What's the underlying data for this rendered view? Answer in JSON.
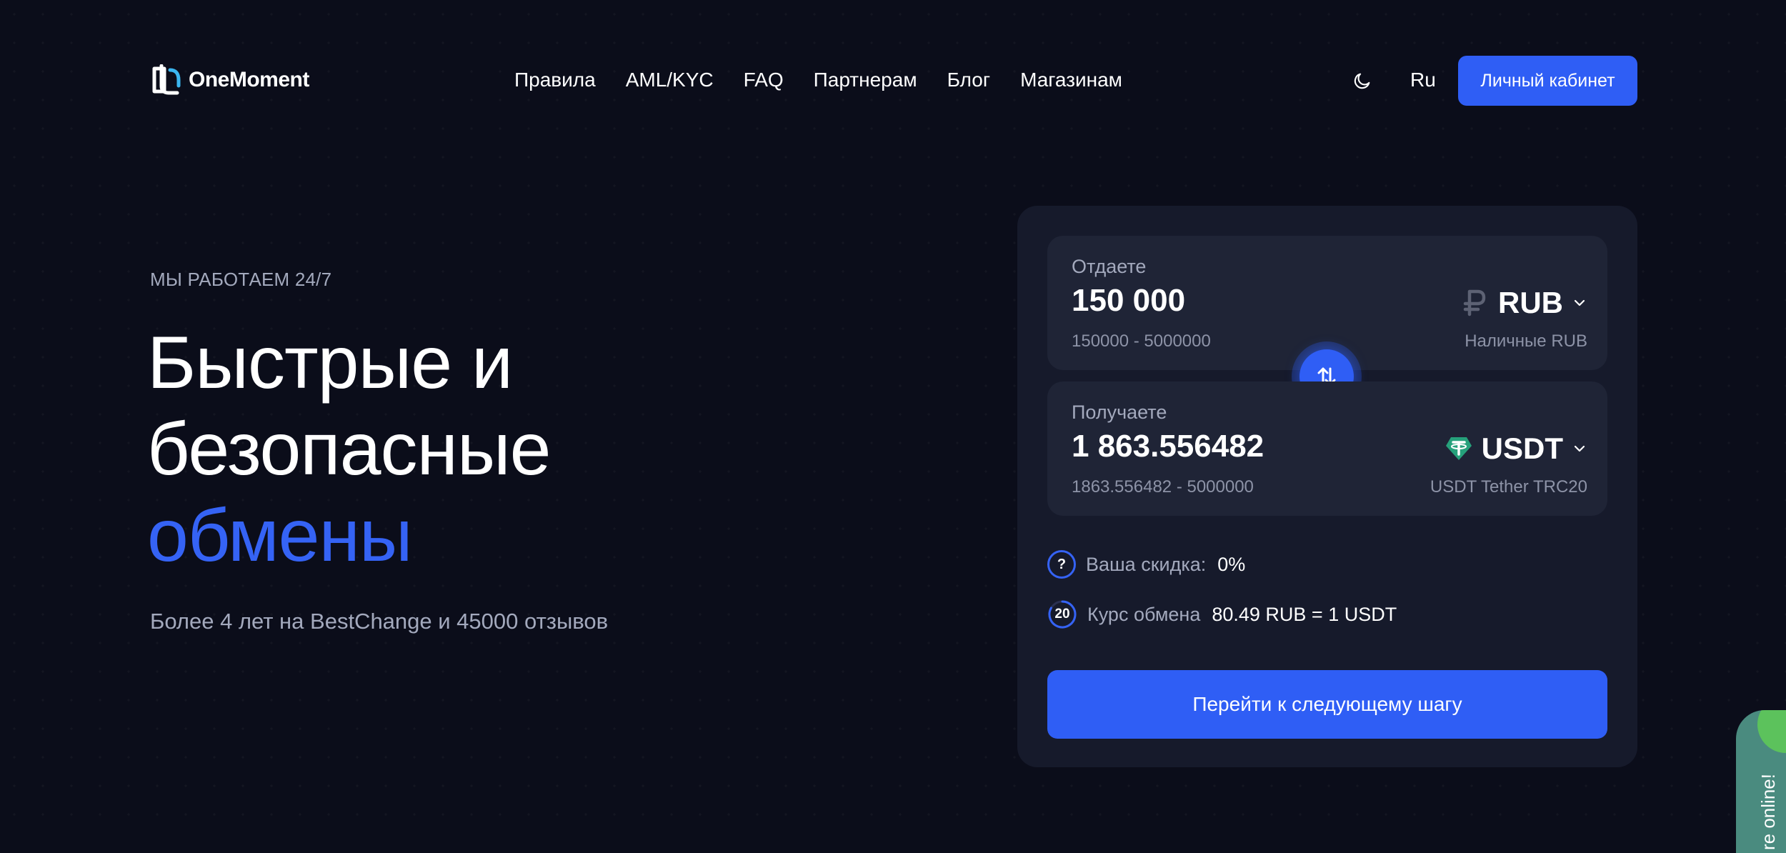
{
  "header": {
    "logo_text": "OneMoment",
    "nav": [
      "Правила",
      "AML/KYC",
      "FAQ",
      "Партнерам",
      "Блог",
      "Магазинам"
    ],
    "theme_icon": "moon-icon",
    "lang": "Ru",
    "cabinet_label": "Личный кабинет"
  },
  "hero": {
    "eyebrow": "МЫ РАБОТАЕМ 24/7",
    "headline_line1": "Быстрые и",
    "headline_line2": "безопасные",
    "headline_accent": "обмены",
    "subtitle": "Более 4 лет на BestChange и 45000 отзывов"
  },
  "exchange": {
    "give": {
      "label": "Отдаете",
      "amount": "150 000",
      "range": "150000 - 5000000",
      "currency": "RUB",
      "currency_icon": "ruble-icon",
      "currency_sub": "Наличные RUB"
    },
    "get": {
      "label": "Получаете",
      "amount": "1 863.556482",
      "range": "1863.556482 - 5000000",
      "currency": "USDT",
      "currency_icon": "tether-icon",
      "currency_sub": "USDT Tether TRC20"
    },
    "discount_label": "Ваша скидка:",
    "discount_value": "0%",
    "help_glyph": "?",
    "rate_label": "Курс обмена",
    "rate_value": "80.49 RUB = 1 USDT",
    "timer": "20",
    "next_label": "Перейти к следующему шагу"
  },
  "widget": {
    "online_text": "re online!"
  },
  "colors": {
    "background": "#0b0d1a",
    "accent": "#2f5ef5",
    "card": "#161a2b",
    "field": "#1f2436",
    "muted_text": "#a3a9bd",
    "tether": "#26a17b",
    "online_green": "#5cc25c"
  }
}
